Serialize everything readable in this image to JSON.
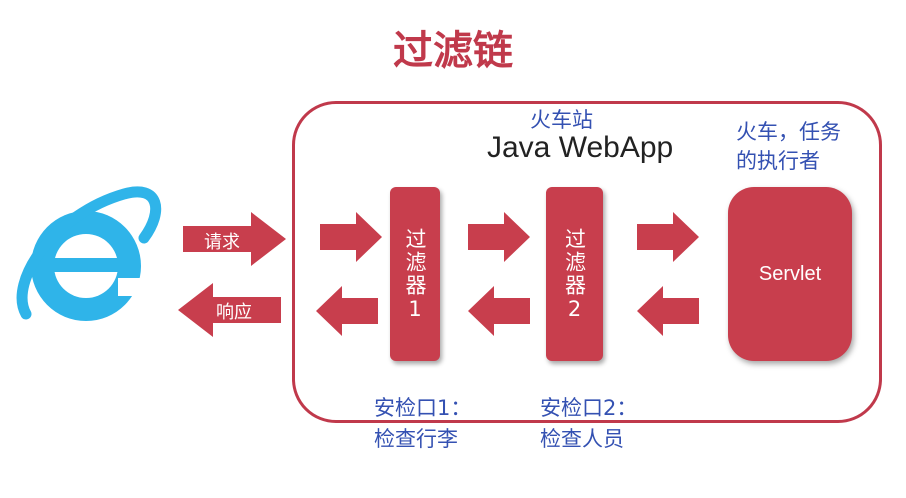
{
  "title": "过滤链",
  "station_label": "火车站",
  "webapp_name": "Java WebApp",
  "servlet_caption": "火车，任务的执行者",
  "request_label": "请求",
  "response_label": "响应",
  "filters": [
    {
      "label": "过滤器",
      "number": "1"
    },
    {
      "label": "过滤器",
      "number": "2"
    }
  ],
  "servlet_label": "Servlet",
  "checkpoints": [
    {
      "line1": "安检口1：",
      "line2": "检查行李"
    },
    {
      "line1": "安检口2：",
      "line2": "检查人员"
    }
  ],
  "colors": {
    "accent": "#c0394b",
    "caption": "#3451b2",
    "browser_icon": "#2fb4e9"
  },
  "icons": {
    "browser": "internet-explorer-icon"
  }
}
